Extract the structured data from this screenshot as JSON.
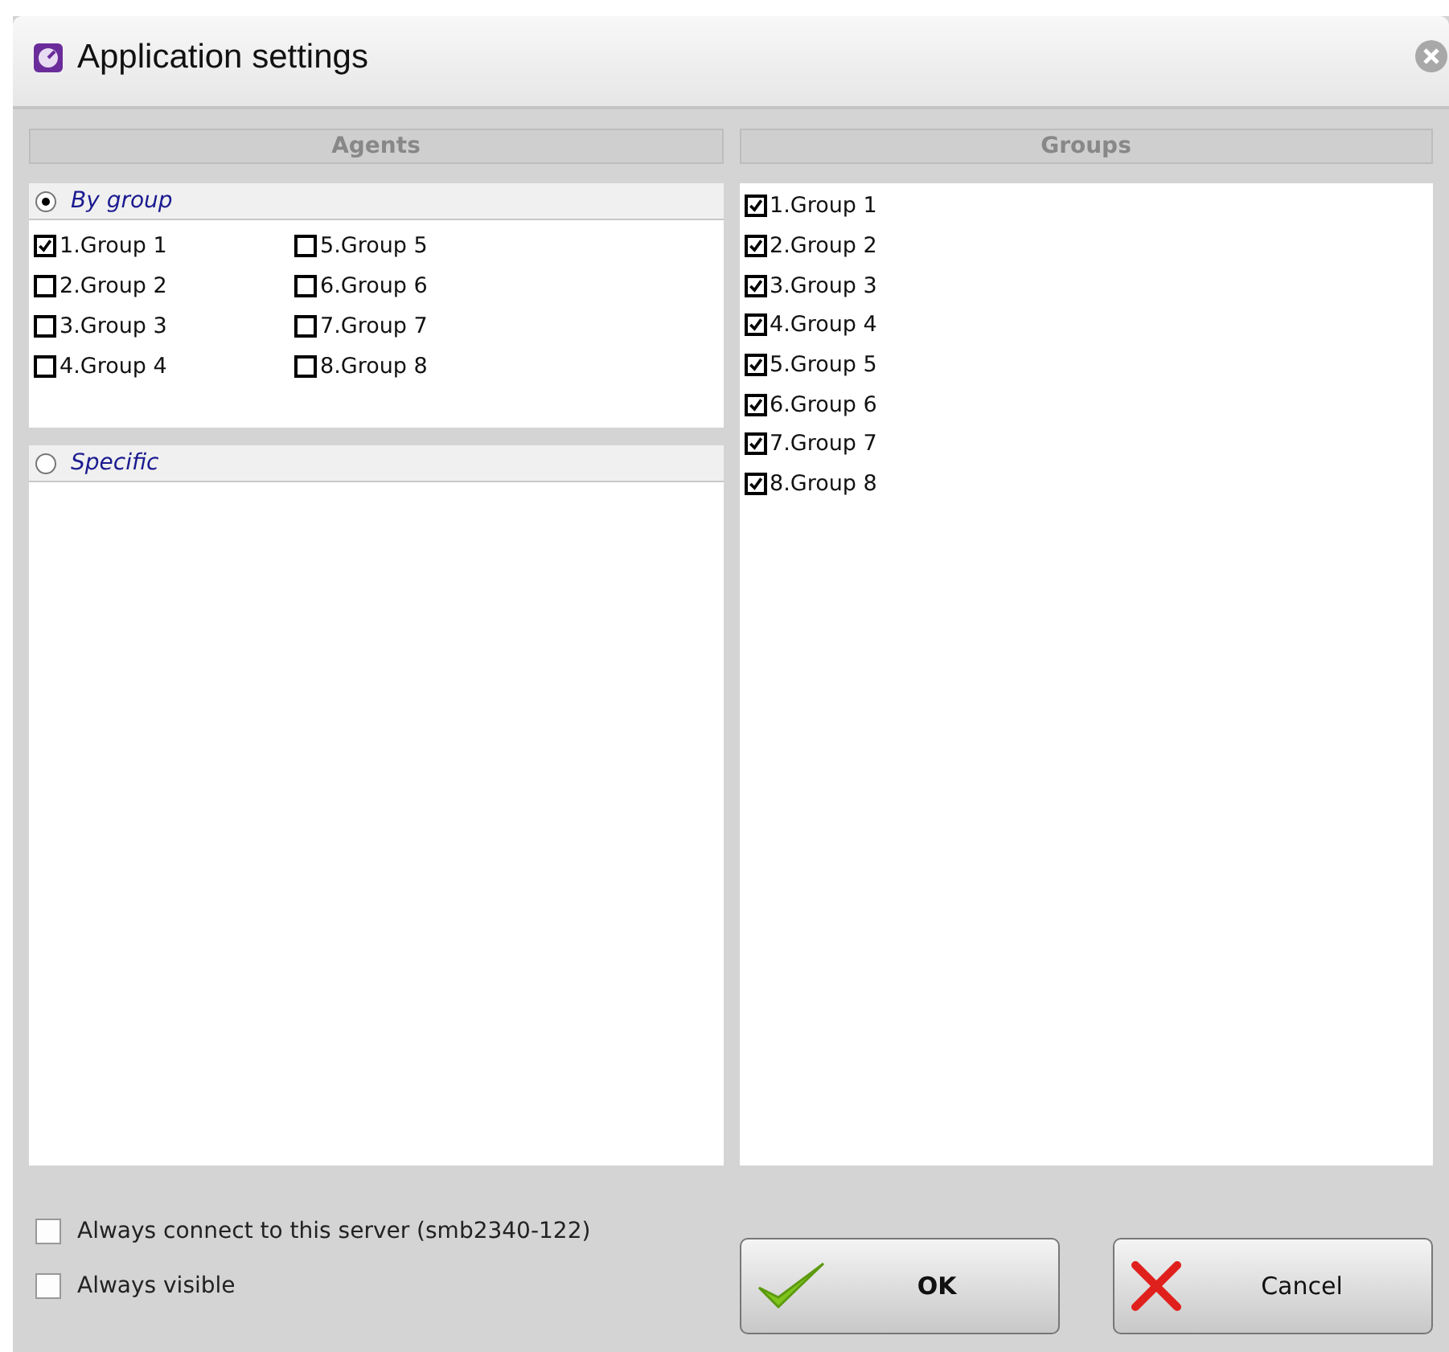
{
  "window": {
    "title": "Application settings"
  },
  "agents": {
    "header": "Agents",
    "modes": [
      {
        "label": "By group",
        "selected": true,
        "groups": [
          {
            "label": "1.Group 1",
            "checked": true
          },
          {
            "label": "2.Group 2",
            "checked": false
          },
          {
            "label": "3.Group 3",
            "checked": false
          },
          {
            "label": "4.Group 4",
            "checked": false
          },
          {
            "label": "5.Group 5",
            "checked": false
          },
          {
            "label": "6.Group 6",
            "checked": false
          },
          {
            "label": "7.Group 7",
            "checked": false
          },
          {
            "label": "8.Group 8",
            "checked": false
          }
        ]
      },
      {
        "label": "Specific",
        "selected": false
      }
    ]
  },
  "groups": {
    "header": "Groups",
    "items": [
      {
        "label": "1.Group 1",
        "checked": true
      },
      {
        "label": "2.Group 2",
        "checked": true
      },
      {
        "label": "3.Group 3",
        "checked": true
      },
      {
        "label": "4.Group 4",
        "checked": true
      },
      {
        "label": "5.Group 5",
        "checked": true
      },
      {
        "label": "6.Group 6",
        "checked": true
      },
      {
        "label": "7.Group 7",
        "checked": true
      },
      {
        "label": "8.Group 8",
        "checked": true
      }
    ]
  },
  "options": [
    {
      "label": "Always connect to this server (smb2340-122)",
      "checked": false
    },
    {
      "label": "Always visible",
      "checked": false
    }
  ],
  "buttons": [
    {
      "label": "OK",
      "kind": "ok"
    },
    {
      "label": "Cancel",
      "kind": "cancel"
    }
  ]
}
